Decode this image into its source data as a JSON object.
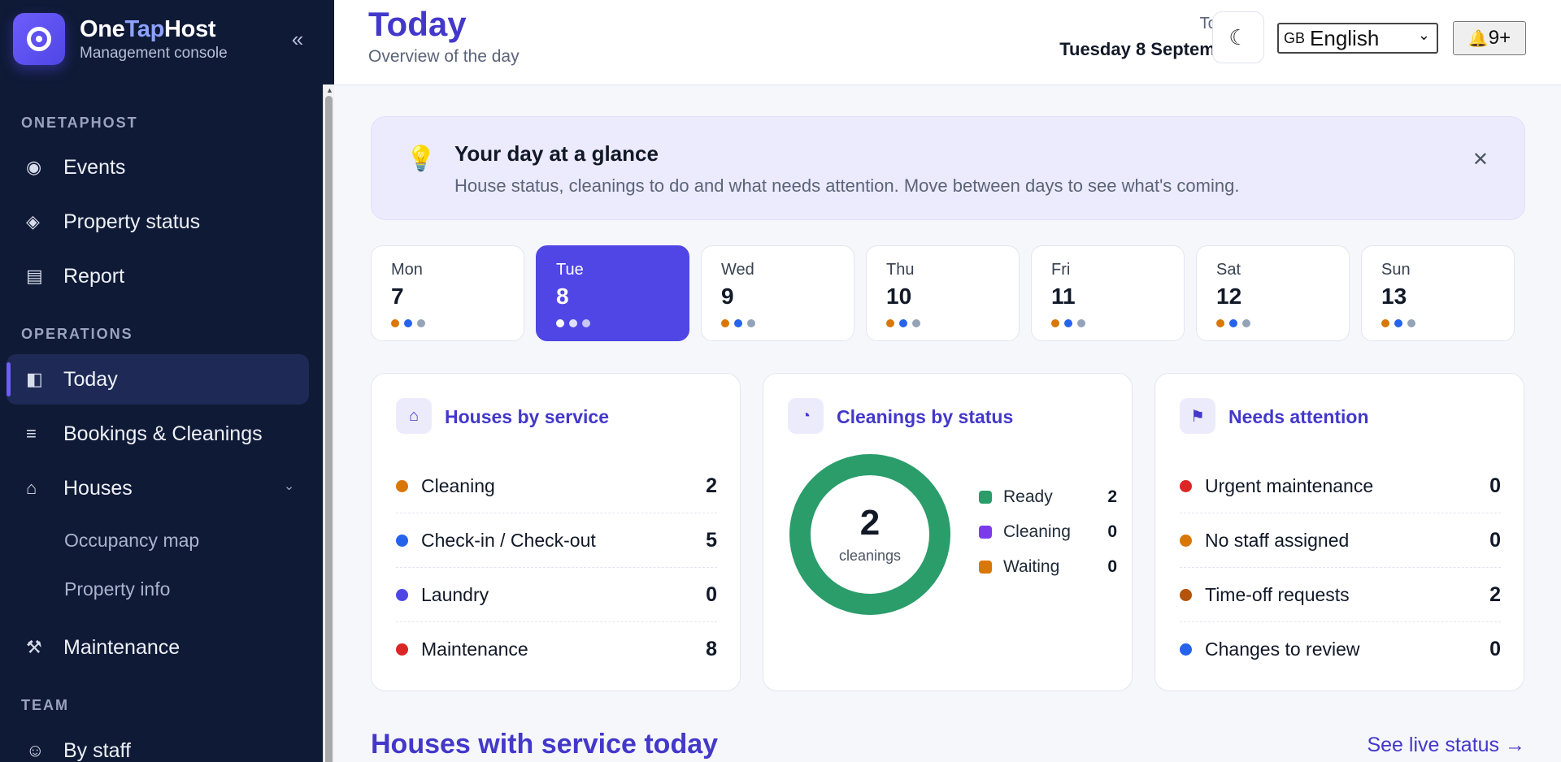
{
  "brand": {
    "name_a": "One",
    "name_b": "Tap",
    "name_c": "Host",
    "subtitle": "Management console"
  },
  "sidebar": {
    "collapse_icon": "«",
    "sections": [
      {
        "label": "ONETAPHOST",
        "items": [
          {
            "label": "Events",
            "icon": "◉"
          },
          {
            "label": "Property status",
            "icon": "◈"
          },
          {
            "label": "Report",
            "icon": "▤"
          }
        ]
      },
      {
        "label": "OPERATIONS",
        "items": [
          {
            "label": "Today",
            "icon": "◧",
            "active": true
          },
          {
            "label": "Bookings & Cleanings",
            "icon": "≡"
          },
          {
            "label": "Houses",
            "icon": "⌂",
            "expanded": true,
            "caret": "›",
            "children": [
              {
                "label": "Occupancy map"
              },
              {
                "label": "Property info"
              }
            ]
          },
          {
            "label": "Maintenance",
            "icon": "⚒"
          }
        ]
      },
      {
        "label": "TEAM",
        "items": [
          {
            "label": "By staff",
            "icon": "☺"
          }
        ]
      }
    ]
  },
  "header": {
    "title": "Today",
    "subtitle": "Overview of the day",
    "date_label": "Today",
    "date_value": "Tuesday 8 September",
    "theme_icon": "☾",
    "language": {
      "flag": "GB",
      "selected": "English"
    },
    "notifications": {
      "icon": "🔔",
      "count": "9+"
    }
  },
  "banner": {
    "icon": "💡",
    "title": "Your day at a glance",
    "text": "House status, cleanings to do and what needs attention. Move between days to see what's coming.",
    "close_icon": "✕"
  },
  "days": [
    {
      "name": "Mon",
      "date": "7",
      "selected": false
    },
    {
      "name": "Tue",
      "date": "8",
      "selected": true
    },
    {
      "name": "Wed",
      "date": "9",
      "selected": false
    },
    {
      "name": "Thu",
      "date": "10",
      "selected": false
    },
    {
      "name": "Fri",
      "date": "11",
      "selected": false
    },
    {
      "name": "Sat",
      "date": "12",
      "selected": false
    },
    {
      "name": "Sun",
      "date": "13",
      "selected": false
    }
  ],
  "day_dot_colors": [
    "#d97706",
    "#2563eb",
    "#94a3b8"
  ],
  "cards": {
    "houses": {
      "title": "Houses by service",
      "icon": "⌂",
      "rows": [
        {
          "label": "Cleaning",
          "value": "2",
          "color": "#d97706"
        },
        {
          "label": "Check-in / Check-out",
          "value": "5",
          "color": "#2563eb"
        },
        {
          "label": "Laundry",
          "value": "0",
          "color": "#4f46e5"
        },
        {
          "label": "Maintenance",
          "value": "8",
          "color": "#dc2626"
        }
      ]
    },
    "cleanings": {
      "title": "Cleanings by status",
      "icon": "◔",
      "total": "2",
      "total_label": "cleanings",
      "legend": [
        {
          "label": "Ready",
          "value": 2,
          "color": "#2a9d6a"
        },
        {
          "label": "Cleaning",
          "value": 0,
          "color": "#7c3aed"
        },
        {
          "label": "Waiting",
          "value": 0,
          "color": "#d97706"
        }
      ]
    },
    "attention": {
      "title": "Needs attention",
      "icon": "⚑",
      "rows": [
        {
          "label": "Urgent maintenance",
          "value": "0",
          "color": "#dc2626"
        },
        {
          "label": "No staff assigned",
          "value": "0",
          "color": "#d97706"
        },
        {
          "label": "Time-off requests",
          "value": "2",
          "color": "#b45309"
        },
        {
          "label": "Changes to review",
          "value": "0",
          "color": "#2563eb"
        }
      ]
    }
  },
  "section": {
    "title": "Houses with service today",
    "link": "See live status →"
  }
}
